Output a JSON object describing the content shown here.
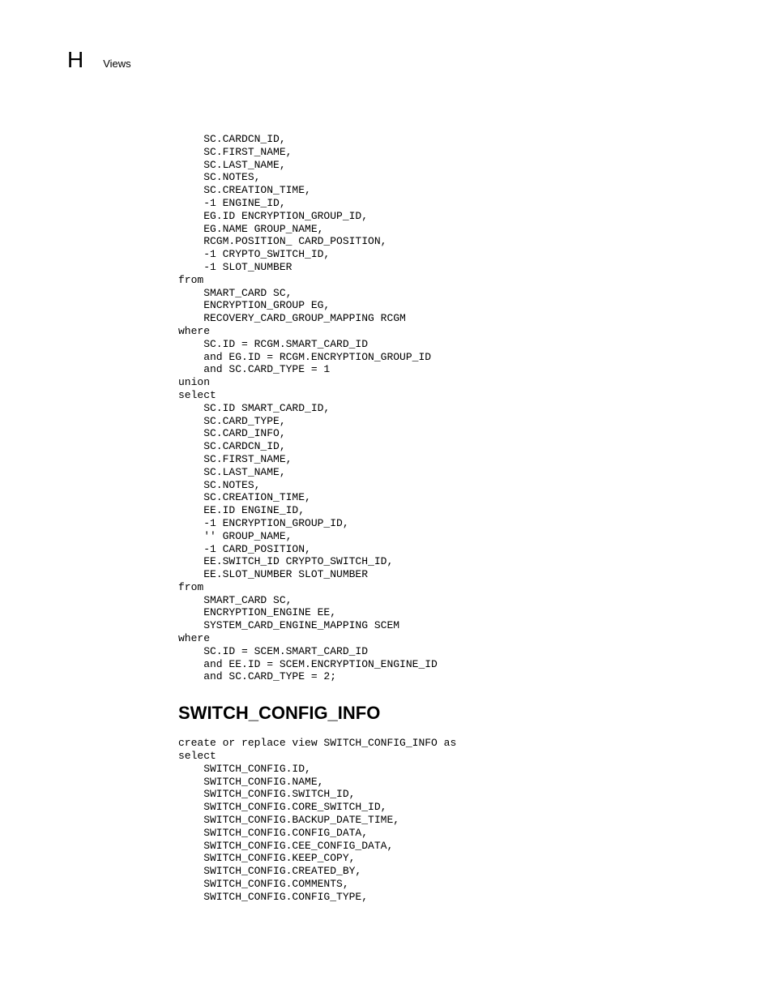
{
  "header": {
    "letter": "H",
    "word": "Views"
  },
  "code_block_1": "    SC.CARDCN_ID,\n    SC.FIRST_NAME,\n    SC.LAST_NAME,\n    SC.NOTES,\n    SC.CREATION_TIME,\n    -1 ENGINE_ID,\n    EG.ID ENCRYPTION_GROUP_ID,\n    EG.NAME GROUP_NAME,\n    RCGM.POSITION_ CARD_POSITION,\n    -1 CRYPTO_SWITCH_ID,\n    -1 SLOT_NUMBER\nfrom\n    SMART_CARD SC,\n    ENCRYPTION_GROUP EG,\n    RECOVERY_CARD_GROUP_MAPPING RCGM\nwhere\n    SC.ID = RCGM.SMART_CARD_ID\n    and EG.ID = RCGM.ENCRYPTION_GROUP_ID\n    and SC.CARD_TYPE = 1\nunion\nselect\n    SC.ID SMART_CARD_ID,\n    SC.CARD_TYPE,\n    SC.CARD_INFO,\n    SC.CARDCN_ID,\n    SC.FIRST_NAME,\n    SC.LAST_NAME,\n    SC.NOTES,\n    SC.CREATION_TIME,\n    EE.ID ENGINE_ID,\n    -1 ENCRYPTION_GROUP_ID,\n    '' GROUP_NAME,\n    -1 CARD_POSITION,\n    EE.SWITCH_ID CRYPTO_SWITCH_ID,\n    EE.SLOT_NUMBER SLOT_NUMBER\nfrom\n    SMART_CARD SC,\n    ENCRYPTION_ENGINE EE,\n    SYSTEM_CARD_ENGINE_MAPPING SCEM\nwhere\n    SC.ID = SCEM.SMART_CARD_ID\n    and EE.ID = SCEM.ENCRYPTION_ENGINE_ID\n    and SC.CARD_TYPE = 2;",
  "section_heading": "SWITCH_CONFIG_INFO",
  "code_block_2": "create or replace view SWITCH_CONFIG_INFO as\nselect\n    SWITCH_CONFIG.ID,\n    SWITCH_CONFIG.NAME,\n    SWITCH_CONFIG.SWITCH_ID,\n    SWITCH_CONFIG.CORE_SWITCH_ID,\n    SWITCH_CONFIG.BACKUP_DATE_TIME,\n    SWITCH_CONFIG.CONFIG_DATA,\n    SWITCH_CONFIG.CEE_CONFIG_DATA,\n    SWITCH_CONFIG.KEEP_COPY,\n    SWITCH_CONFIG.CREATED_BY,\n    SWITCH_CONFIG.COMMENTS,\n    SWITCH_CONFIG.CONFIG_TYPE,"
}
